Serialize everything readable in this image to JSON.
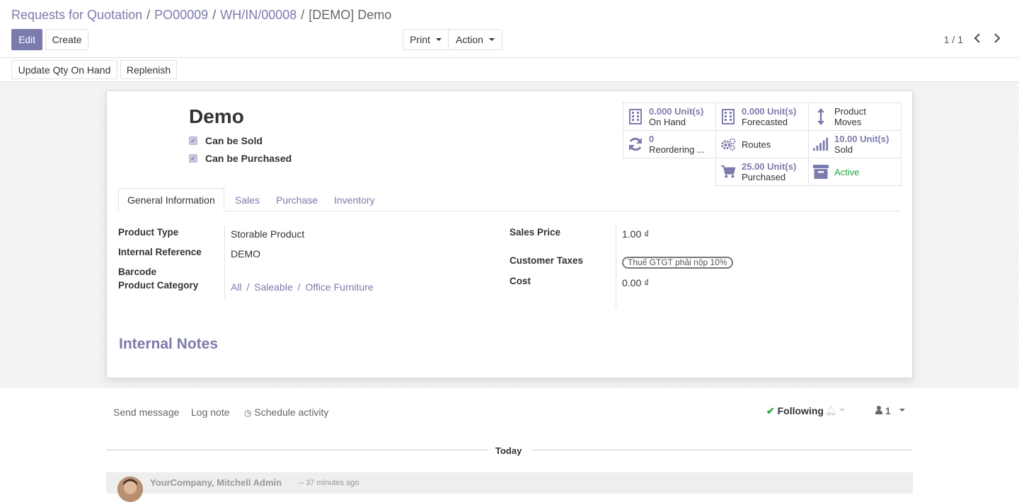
{
  "breadcrumb": [
    "Requests for Quotation",
    "PO00009",
    "WH/IN/00008",
    "[DEMO] Demo"
  ],
  "toolbar": {
    "edit": "Edit",
    "create": "Create",
    "print": "Print",
    "action": "Action"
  },
  "pager": {
    "value": "1 / 1"
  },
  "statusbar": {
    "update_qty": "Update Qty On Hand",
    "replenish": "Replenish"
  },
  "product": {
    "name": "Demo",
    "can_be_sold_label": "Can be Sold",
    "can_be_purchased_label": "Can be Purchased",
    "can_be_sold": true,
    "can_be_purchased": true
  },
  "smart_buttons": {
    "on_hand_value": "0.000 Unit(s)",
    "on_hand_label": "On Hand",
    "forecasted_value": "0.000 Unit(s)",
    "forecasted_label": "Forecasted",
    "moves_line1": "Product",
    "moves_line2": "Moves",
    "reordering_value": "0",
    "reordering_label": "Reordering ...",
    "routes_label": "Routes",
    "sold_value": "10.00 Unit(s)",
    "sold_label": "Sold",
    "purchased_value": "25.00 Unit(s)",
    "purchased_label": "Purchased",
    "active_label": "Active",
    "active_color": "#28a745"
  },
  "tabs": [
    "General Information",
    "Sales",
    "Purchase",
    "Inventory"
  ],
  "fields": {
    "product_type_label": "Product Type",
    "product_type": "Storable Product",
    "internal_ref_label": "Internal Reference",
    "internal_ref": "DEMO",
    "barcode_label": "Barcode",
    "category_label": "Product Category",
    "category_parts": [
      "All",
      "Saleable",
      "Office Furniture"
    ],
    "sales_price_label": "Sales Price",
    "sales_price": "1.00 ₫",
    "customer_taxes_label": "Customer Taxes",
    "customer_tax": "Thuế GTGT phải nộp 10%",
    "cost_label": "Cost",
    "cost": "0.00 ₫"
  },
  "internal_notes": "Internal Notes",
  "chatter": {
    "send_message": "Send message",
    "log_note": "Log note",
    "schedule_activity": "Schedule activity",
    "following": "Following",
    "followers_count": "1",
    "today": "Today",
    "author": "YourCompany, Mitchell Admin",
    "time_ago": "37 minutes ago"
  },
  "colors": {
    "brand": "#7c7bad"
  }
}
